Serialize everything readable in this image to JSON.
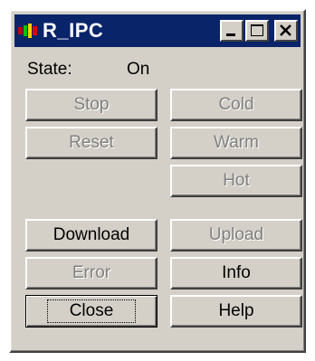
{
  "window": {
    "title": "R_IPC"
  },
  "state": {
    "label": "State:",
    "value": "On"
  },
  "buttons": {
    "stop": "Stop",
    "cold": "Cold",
    "reset": "Reset",
    "warm": "Warm",
    "hot": "Hot",
    "download": "Download",
    "upload": "Upload",
    "error": "Error",
    "info": "Info",
    "close": "Close",
    "help": "Help"
  },
  "icons": {
    "app": "app-icon",
    "minimize": "minimize-icon",
    "maximize": "maximize-icon",
    "close": "close-icon"
  },
  "colors": {
    "titlebar": "#0a246a",
    "face": "#d4d0c8",
    "disabled_text": "#808080"
  }
}
